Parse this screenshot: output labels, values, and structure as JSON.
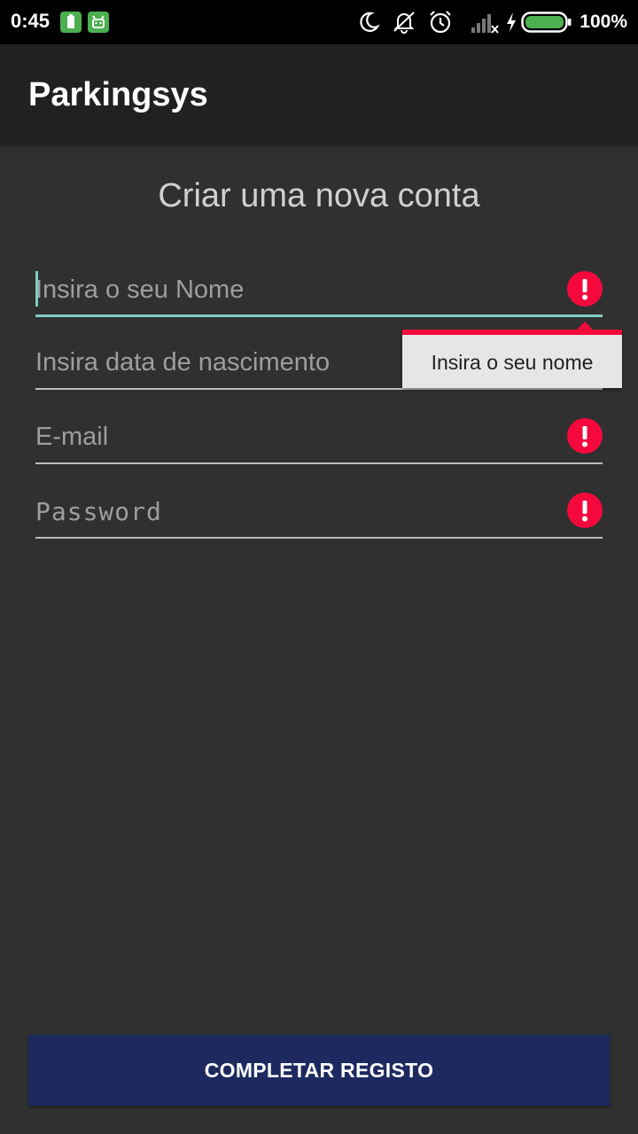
{
  "status_bar": {
    "time": "0:45",
    "battery_percent": "100%",
    "icons": [
      "battery-notification-icon",
      "android-notification-icon",
      "moon-icon",
      "vibrate-off-icon",
      "alarm-icon",
      "signal-icon",
      "charging-icon",
      "battery-icon"
    ]
  },
  "app_bar": {
    "title": "Parkingsys"
  },
  "form": {
    "heading": "Criar uma nova conta",
    "fields": [
      {
        "name": "name",
        "placeholder": "Insira o seu Nome",
        "value": "",
        "focused": true,
        "error": true
      },
      {
        "name": "birthdate",
        "placeholder": "Insira data de nascimento",
        "value": "",
        "focused": false,
        "error": true
      },
      {
        "name": "email",
        "placeholder": "E-mail",
        "value": "",
        "focused": false,
        "error": true
      },
      {
        "name": "password",
        "placeholder": "Password",
        "value": "",
        "focused": false,
        "error": true
      }
    ],
    "error_popup": {
      "text": "Insira o seu nome"
    },
    "submit_label": "COMPLETAR REGISTO"
  },
  "colors": {
    "background": "#303030",
    "toolbar": "#212121",
    "accent": "#80cbc4",
    "error": "#f5093c",
    "button": "#1e2a5f"
  }
}
